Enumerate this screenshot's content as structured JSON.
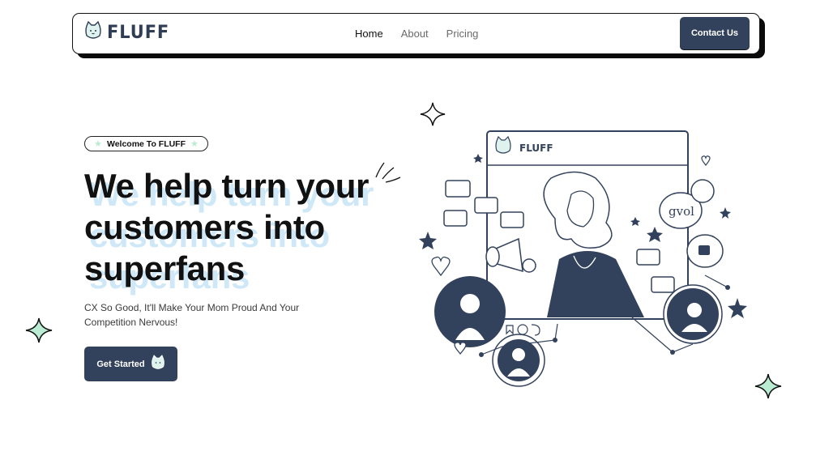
{
  "brand": {
    "name": "FLUFF",
    "logo_icon": "cat-face-icon"
  },
  "nav": {
    "links": [
      {
        "label": "Home",
        "active": true
      },
      {
        "label": "About",
        "active": false
      },
      {
        "label": "Pricing",
        "active": false
      }
    ],
    "contact_label": "Contact Us"
  },
  "hero": {
    "badge": "Welcome To FLUFF",
    "headline": [
      "We help turn your",
      "customers into",
      "superfans"
    ],
    "subtext_lines": [
      "CX So Good, It'll Make Your Mom Proud And Your",
      "Competition Nervous!"
    ],
    "cta_label": "Get Started"
  },
  "illustration": {
    "window_brand": "FLUFF",
    "speech_bubble_text": "gvol"
  },
  "colors": {
    "primary": "#33425c",
    "accent_mint": "#b9ecd2",
    "headline_shadow": "#cfe8f7"
  }
}
